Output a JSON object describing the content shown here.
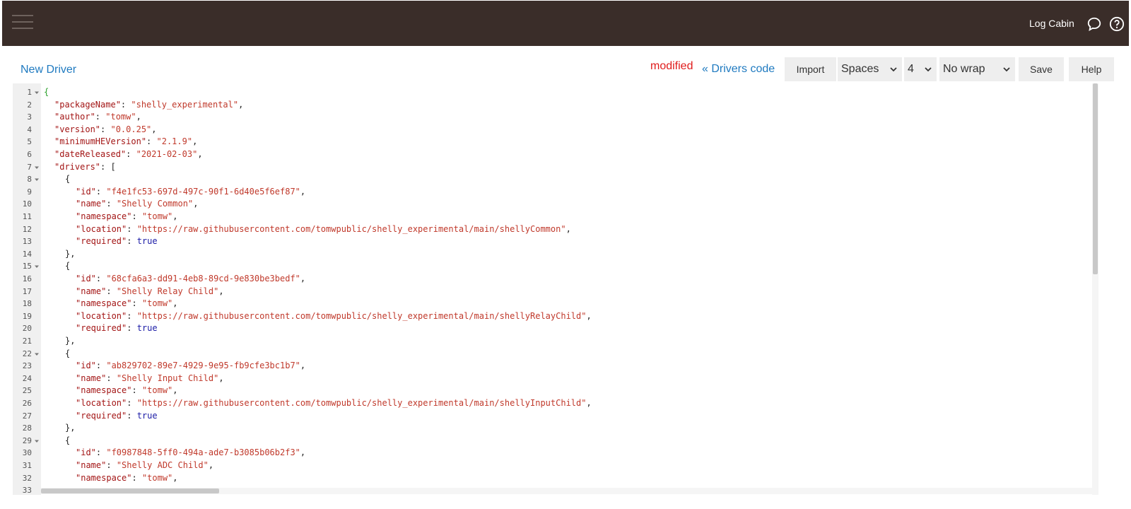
{
  "topbar": {
    "location_name": "Log Cabin",
    "icons": [
      "hamburger-menu-icon",
      "chat-bubble-icon",
      "help-circle-icon"
    ]
  },
  "header": {
    "title": "New Driver",
    "status": "modified",
    "back_link": "« Drivers code"
  },
  "toolbar": {
    "import_label": "Import",
    "indent_type": "Spaces",
    "indent_size": "4",
    "wrap_mode": "No wrap",
    "save_label": "Save",
    "help_label": "Help"
  },
  "colors": {
    "topbar_bg": "#3a2d29",
    "link": "#1f7ac0",
    "modified": "#e01b1b",
    "json_key": "#a31515",
    "json_string": "#c0392b",
    "json_bool": "#1a1aa6"
  },
  "editor": {
    "lines": [
      {
        "n": "1",
        "fold": true,
        "indent": 0,
        "tokens": [
          [
            "brace-green",
            "{"
          ]
        ]
      },
      {
        "n": "2",
        "indent": 1,
        "tokens": [
          [
            "key",
            "\"packageName\""
          ],
          [
            "punc",
            ": "
          ],
          [
            "str",
            "\"shelly_experimental\""
          ],
          [
            "punc",
            ","
          ]
        ]
      },
      {
        "n": "3",
        "indent": 1,
        "tokens": [
          [
            "key",
            "\"author\""
          ],
          [
            "punc",
            ": "
          ],
          [
            "str",
            "\"tomw\""
          ],
          [
            "punc",
            ","
          ]
        ]
      },
      {
        "n": "4",
        "indent": 1,
        "tokens": [
          [
            "key",
            "\"version\""
          ],
          [
            "punc",
            ": "
          ],
          [
            "str",
            "\"0.0.25\""
          ],
          [
            "punc",
            ","
          ]
        ]
      },
      {
        "n": "5",
        "indent": 1,
        "tokens": [
          [
            "key",
            "\"minimumHEVersion\""
          ],
          [
            "punc",
            ": "
          ],
          [
            "str",
            "\"2.1.9\""
          ],
          [
            "punc",
            ","
          ]
        ]
      },
      {
        "n": "6",
        "indent": 1,
        "tokens": [
          [
            "key",
            "\"dateReleased\""
          ],
          [
            "punc",
            ": "
          ],
          [
            "str",
            "\"2021-02-03\""
          ],
          [
            "punc",
            ","
          ]
        ]
      },
      {
        "n": "7",
        "fold": true,
        "indent": 1,
        "tokens": [
          [
            "key",
            "\"drivers\""
          ],
          [
            "punc",
            ": ["
          ]
        ]
      },
      {
        "n": "8",
        "fold": true,
        "indent": 2,
        "tokens": [
          [
            "punc",
            "{"
          ]
        ]
      },
      {
        "n": "9",
        "indent": 3,
        "tokens": [
          [
            "key",
            "\"id\""
          ],
          [
            "punc",
            ": "
          ],
          [
            "str",
            "\"f4e1fc53-697d-497c-90f1-6d40e5f6ef87\""
          ],
          [
            "punc",
            ","
          ]
        ]
      },
      {
        "n": "10",
        "indent": 3,
        "tokens": [
          [
            "key",
            "\"name\""
          ],
          [
            "punc",
            ": "
          ],
          [
            "str",
            "\"Shelly Common\""
          ],
          [
            "punc",
            ","
          ]
        ]
      },
      {
        "n": "11",
        "indent": 3,
        "tokens": [
          [
            "key",
            "\"namespace\""
          ],
          [
            "punc",
            ": "
          ],
          [
            "str",
            "\"tomw\""
          ],
          [
            "punc",
            ","
          ]
        ]
      },
      {
        "n": "12",
        "indent": 3,
        "tokens": [
          [
            "key",
            "\"location\""
          ],
          [
            "punc",
            ": "
          ],
          [
            "str",
            "\"https://raw.githubusercontent.com/tomwpublic/shelly_experimental/main/shellyCommon\""
          ],
          [
            "punc",
            ","
          ]
        ]
      },
      {
        "n": "13",
        "indent": 3,
        "tokens": [
          [
            "key",
            "\"required\""
          ],
          [
            "punc",
            ": "
          ],
          [
            "bool",
            "true"
          ]
        ]
      },
      {
        "n": "14",
        "indent": 2,
        "tokens": [
          [
            "punc",
            "},"
          ]
        ]
      },
      {
        "n": "15",
        "fold": true,
        "indent": 2,
        "tokens": [
          [
            "punc",
            "{"
          ]
        ]
      },
      {
        "n": "16",
        "indent": 3,
        "tokens": [
          [
            "key",
            "\"id\""
          ],
          [
            "punc",
            ": "
          ],
          [
            "str",
            "\"68cfa6a3-dd91-4eb8-89cd-9e830be3bedf\""
          ],
          [
            "punc",
            ","
          ]
        ]
      },
      {
        "n": "17",
        "indent": 3,
        "tokens": [
          [
            "key",
            "\"name\""
          ],
          [
            "punc",
            ": "
          ],
          [
            "str",
            "\"Shelly Relay Child\""
          ],
          [
            "punc",
            ","
          ]
        ]
      },
      {
        "n": "18",
        "indent": 3,
        "tokens": [
          [
            "key",
            "\"namespace\""
          ],
          [
            "punc",
            ": "
          ],
          [
            "str",
            "\"tomw\""
          ],
          [
            "punc",
            ","
          ]
        ]
      },
      {
        "n": "19",
        "indent": 3,
        "tokens": [
          [
            "key",
            "\"location\""
          ],
          [
            "punc",
            ": "
          ],
          [
            "str",
            "\"https://raw.githubusercontent.com/tomwpublic/shelly_experimental/main/shellyRelayChild\""
          ],
          [
            "punc",
            ","
          ]
        ]
      },
      {
        "n": "20",
        "indent": 3,
        "tokens": [
          [
            "key",
            "\"required\""
          ],
          [
            "punc",
            ": "
          ],
          [
            "bool",
            "true"
          ]
        ]
      },
      {
        "n": "21",
        "indent": 2,
        "tokens": [
          [
            "punc",
            "},"
          ]
        ]
      },
      {
        "n": "22",
        "fold": true,
        "indent": 2,
        "tokens": [
          [
            "punc",
            "{"
          ]
        ]
      },
      {
        "n": "23",
        "indent": 3,
        "tokens": [
          [
            "key",
            "\"id\""
          ],
          [
            "punc",
            ": "
          ],
          [
            "str",
            "\"ab829702-89e7-4929-9e95-fb9cfe3bc1b7\""
          ],
          [
            "punc",
            ","
          ]
        ]
      },
      {
        "n": "24",
        "indent": 3,
        "tokens": [
          [
            "key",
            "\"name\""
          ],
          [
            "punc",
            ": "
          ],
          [
            "str",
            "\"Shelly Input Child\""
          ],
          [
            "punc",
            ","
          ]
        ]
      },
      {
        "n": "25",
        "indent": 3,
        "tokens": [
          [
            "key",
            "\"namespace\""
          ],
          [
            "punc",
            ": "
          ],
          [
            "str",
            "\"tomw\""
          ],
          [
            "punc",
            ","
          ]
        ]
      },
      {
        "n": "26",
        "indent": 3,
        "tokens": [
          [
            "key",
            "\"location\""
          ],
          [
            "punc",
            ": "
          ],
          [
            "str",
            "\"https://raw.githubusercontent.com/tomwpublic/shelly_experimental/main/shellyInputChild\""
          ],
          [
            "punc",
            ","
          ]
        ]
      },
      {
        "n": "27",
        "indent": 3,
        "tokens": [
          [
            "key",
            "\"required\""
          ],
          [
            "punc",
            ": "
          ],
          [
            "bool",
            "true"
          ]
        ]
      },
      {
        "n": "28",
        "indent": 2,
        "tokens": [
          [
            "punc",
            "},"
          ]
        ]
      },
      {
        "n": "29",
        "fold": true,
        "indent": 2,
        "tokens": [
          [
            "punc",
            "{"
          ]
        ]
      },
      {
        "n": "30",
        "indent": 3,
        "tokens": [
          [
            "key",
            "\"id\""
          ],
          [
            "punc",
            ": "
          ],
          [
            "str",
            "\"f0987848-5ff0-494a-ade7-b3085b06b2f3\""
          ],
          [
            "punc",
            ","
          ]
        ]
      },
      {
        "n": "31",
        "indent": 3,
        "tokens": [
          [
            "key",
            "\"name\""
          ],
          [
            "punc",
            ": "
          ],
          [
            "str",
            "\"Shelly ADC Child\""
          ],
          [
            "punc",
            ","
          ]
        ]
      },
      {
        "n": "32",
        "indent": 3,
        "tokens": [
          [
            "key",
            "\"namespace\""
          ],
          [
            "punc",
            ": "
          ],
          [
            "str",
            "\"tomw\""
          ],
          [
            "punc",
            ","
          ]
        ]
      },
      {
        "n": "33",
        "indent": 3,
        "tokens": []
      }
    ]
  }
}
